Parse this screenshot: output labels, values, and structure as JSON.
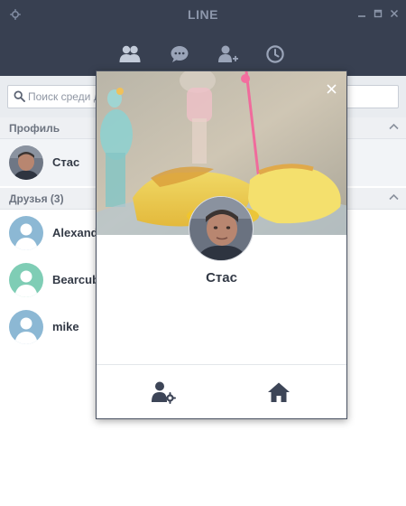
{
  "app": {
    "title": "LINE"
  },
  "window": {
    "controls": [
      "minimize",
      "maximize",
      "close"
    ]
  },
  "nav": {
    "tabs": [
      {
        "id": "friends",
        "icon": "friends-icon",
        "active": true
      },
      {
        "id": "chats",
        "icon": "chat-bubble-icon",
        "active": false
      },
      {
        "id": "add-friend",
        "icon": "add-friend-icon",
        "active": false
      },
      {
        "id": "timeline",
        "icon": "clock-icon",
        "active": false
      }
    ]
  },
  "search": {
    "placeholder": "Поиск среди друзей",
    "value": ""
  },
  "sections": {
    "profile": {
      "label": "Профиль"
    },
    "friends": {
      "label": "Друзья (3)"
    }
  },
  "profile_entry": {
    "name": "Стас"
  },
  "friends": [
    {
      "name": "Alexander",
      "avatar_color": "#8cb8d4"
    },
    {
      "name": "Bearcub",
      "avatar_color": "#7fcdb5"
    },
    {
      "name": "mike",
      "avatar_color": "#8cb8d4"
    }
  ],
  "popup": {
    "name": "Стас",
    "actions": [
      {
        "id": "profile-settings",
        "icon": "user-settings-icon"
      },
      {
        "id": "home",
        "icon": "home-icon"
      }
    ]
  },
  "colors": {
    "header_bg": "#384051",
    "header_icon": "#a9b3c6",
    "section_bg": "#eef0f3",
    "icon_dark": "#3d4557"
  }
}
